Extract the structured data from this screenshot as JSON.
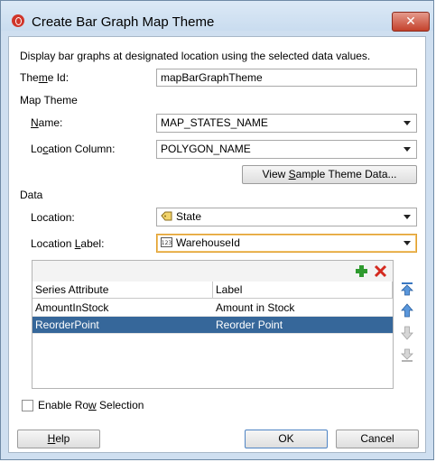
{
  "dialog": {
    "title": "Create Bar Graph Map Theme",
    "close_label": "✕",
    "description": "Display bar graphs at designated location using the selected data values.",
    "theme_id": {
      "label_pre": "The",
      "label_mn": "m",
      "label_post": "e Id:",
      "value": "mapBarGraphTheme"
    },
    "map_theme_section": "Map Theme",
    "name": {
      "label_mn": "N",
      "label_post": "ame:",
      "value": "MAP_STATES_NAME"
    },
    "location_column": {
      "label_pre": "Lo",
      "label_mn": "c",
      "label_post": "ation Column:",
      "value": "POLYGON_NAME"
    },
    "view_sample": {
      "pre": "View ",
      "mn": "S",
      "post": "ample Theme Data..."
    },
    "data_section": "Data",
    "location": {
      "label_pre": "Location:",
      "value": "State",
      "icon": "tag-icon"
    },
    "location_label": {
      "label_pre": "Location ",
      "label_mn": "L",
      "label_post": "abel:",
      "value": "WarehouseId",
      "icon": "numeric-field-icon"
    },
    "table": {
      "columns": [
        "Series Attribute",
        "Label"
      ],
      "rows": [
        {
          "attribute": "AmountInStock",
          "label": "Amount in Stock"
        },
        {
          "attribute": "ReorderPoint",
          "label": "Reorder Point"
        }
      ],
      "selected_row": 1
    },
    "enable_row_selection": {
      "pre": "Enable Ro",
      "mn": "w",
      "post": " Selection",
      "checked": false
    },
    "buttons": {
      "help": {
        "mn": "H",
        "post": "elp"
      },
      "ok": "OK",
      "cancel": "Cancel"
    },
    "colors": {
      "selection": "#36679a",
      "add": "#2f9a2f",
      "remove": "#d42a1f",
      "arrow": "#3a78c2"
    }
  }
}
